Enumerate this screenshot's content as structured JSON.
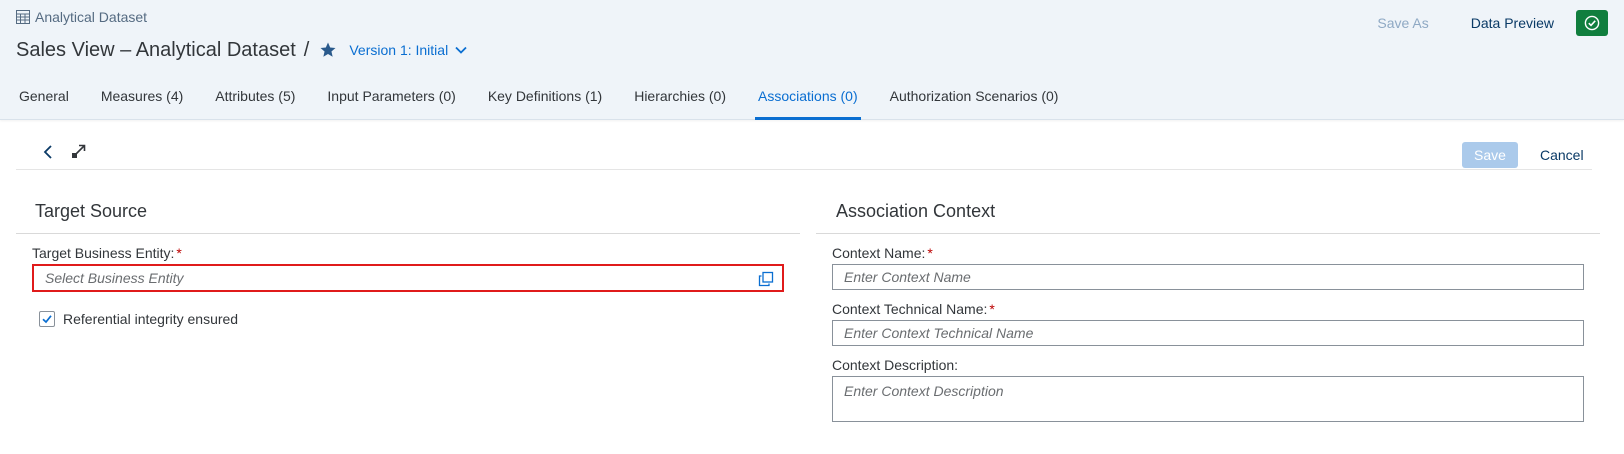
{
  "header": {
    "object_type": "Analytical Dataset",
    "title": "Sales View – Analytical Dataset",
    "separator": "/",
    "version": "Version 1: Initial",
    "actions": {
      "save_as": "Save As",
      "data_preview": "Data Preview"
    },
    "colors": {
      "accent": "#0a6ed1",
      "success": "#107e3e",
      "error": "#e01b1b"
    }
  },
  "tabs": [
    {
      "label": "General"
    },
    {
      "label": "Measures (4)"
    },
    {
      "label": "Attributes (5)"
    },
    {
      "label": "Input Parameters (0)"
    },
    {
      "label": "Key Definitions (1)"
    },
    {
      "label": "Hierarchies (0)"
    },
    {
      "label": "Associations (0)",
      "active": true
    },
    {
      "label": "Authorization Scenarios (0)"
    }
  ],
  "toolbar": {
    "save": "Save",
    "cancel": "Cancel",
    "icons": [
      "back-icon",
      "expand-icon"
    ]
  },
  "target_source": {
    "title": "Target Source",
    "entity_label": "Target Business Entity:",
    "required_mark": "*",
    "entity_placeholder": "Select Business Entity",
    "referential_label": "Referential integrity ensured",
    "referential_checked": true
  },
  "association_context": {
    "title": "Association Context",
    "name_label": "Context Name:",
    "name_placeholder": "Enter Context Name",
    "tech_name_label": "Context Technical Name:",
    "tech_name_placeholder": "Enter Context Technical Name",
    "description_label": "Context Description:",
    "description_placeholder": "Enter Context Description",
    "required_mark": "*"
  }
}
